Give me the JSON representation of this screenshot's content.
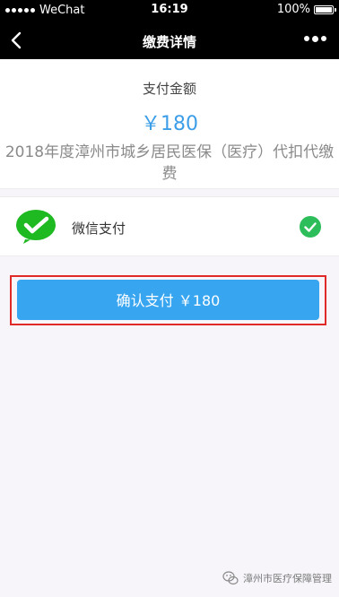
{
  "status_bar": {
    "carrier": "WeChat",
    "time": "16:19",
    "battery": "100%",
    "battery_level": 1.0
  },
  "nav": {
    "title": "缴费详情"
  },
  "amount": {
    "label": "支付金额",
    "value": "￥180",
    "description": "2018年度漳州市城乡居民医保（医疗）代扣代缴费"
  },
  "pay_method": {
    "label": "微信支付",
    "selected": true
  },
  "confirm": {
    "label": "确认支付 ￥180"
  },
  "watermark": {
    "text": "漳州市医疗保障管理"
  },
  "colors": {
    "accent": "#38a5f1",
    "amount": "#3d9ee8",
    "wechat_green": "#1fb922",
    "check_green": "#2dbd5a",
    "highlight_red": "#e02a2a"
  }
}
